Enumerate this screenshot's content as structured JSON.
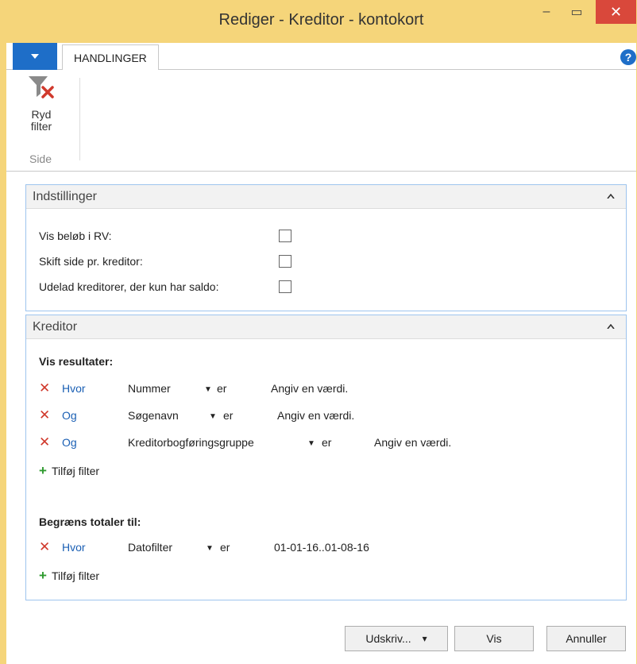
{
  "window": {
    "title": "Rediger - Kreditor - kontokort",
    "minimize": "–",
    "maximize": "▭",
    "close": "✕"
  },
  "ribbon": {
    "app_menu_icon": "caret-down-icon",
    "tab": "HANDLINGER",
    "help": "?",
    "clear_filter_label_1": "Ryd",
    "clear_filter_label_2": "filter",
    "group_label": "Side"
  },
  "options": {
    "title": "Indstillinger",
    "rows": [
      {
        "label": "Vis beløb i RV:",
        "checked": false
      },
      {
        "label": "Skift side pr. kreditor:",
        "checked": false
      },
      {
        "label": "Udelad kreditorer, der kun har saldo:",
        "checked": false
      }
    ]
  },
  "vendor": {
    "title": "Kreditor",
    "show_results": "Vis resultater:",
    "filters": [
      {
        "conj": "Hvor",
        "field": "Nummer",
        "op": "er",
        "value": "Angiv en værdi."
      },
      {
        "conj": "Og",
        "field": "Søgenavn",
        "op": "er",
        "value": "Angiv en værdi."
      },
      {
        "conj": "Og",
        "field": "Kreditorbogføringsgruppe",
        "op": "er",
        "value": "Angiv en værdi."
      }
    ],
    "add_filter": "Tilføj filter",
    "limit_totals": "Begræns totaler til:",
    "total_filters": [
      {
        "conj": "Hvor",
        "field": "Datofilter",
        "op": "er",
        "value": "01-01-16..01-08-16"
      }
    ],
    "add_filter_2": "Tilføj filter"
  },
  "footer": {
    "print": "Udskriv...",
    "print_arrow": "▾",
    "view": "Vis",
    "cancel": "Annuller"
  },
  "colors": {
    "titlebar": "#f5d57a",
    "close": "#d9483b",
    "accent": "#1e6ec8",
    "remove": "#d0392c",
    "add": "#2e9a2e",
    "link": "#1a5fb4"
  }
}
